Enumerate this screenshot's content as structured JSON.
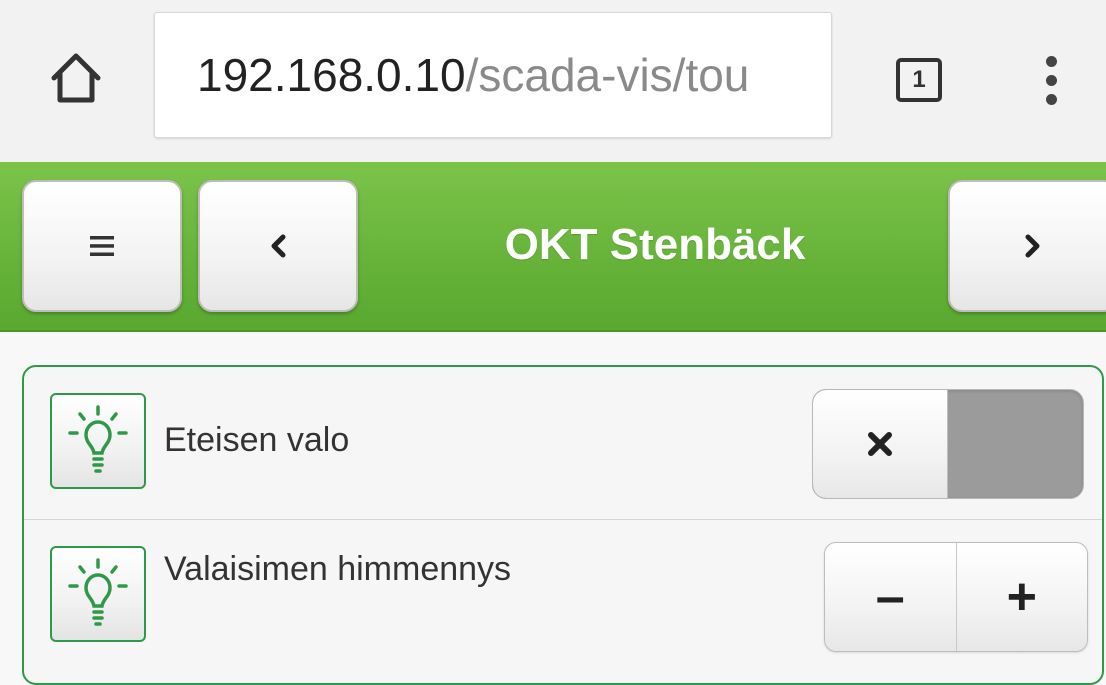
{
  "browser": {
    "url_host": "192.168.0.10",
    "url_path": "/scada-vis/tou",
    "tab_count": "1",
    "icons": {
      "home": "home-icon",
      "tabs": "tabs-counter-icon",
      "menu": "vertical-dots-menu-icon"
    }
  },
  "header": {
    "title": "OKT Stenbäck",
    "background_color": "#6ab63c",
    "icons": {
      "menu": "hamburger-menu-icon",
      "prev": "chevron-left-icon",
      "next": "chevron-right-icon"
    }
  },
  "controls": {
    "accent_color": "#2e9a47",
    "items": [
      {
        "label": "Eteisen valo",
        "icon": "light-bulb-icon",
        "control": "toggle",
        "state": "off",
        "toggle_icon": "close-x-icon"
      },
      {
        "label": "Valaisimen himmennys",
        "icon": "light-bulb-icon",
        "control": "stepper",
        "minus_label": "–",
        "plus_label": "+"
      }
    ]
  }
}
